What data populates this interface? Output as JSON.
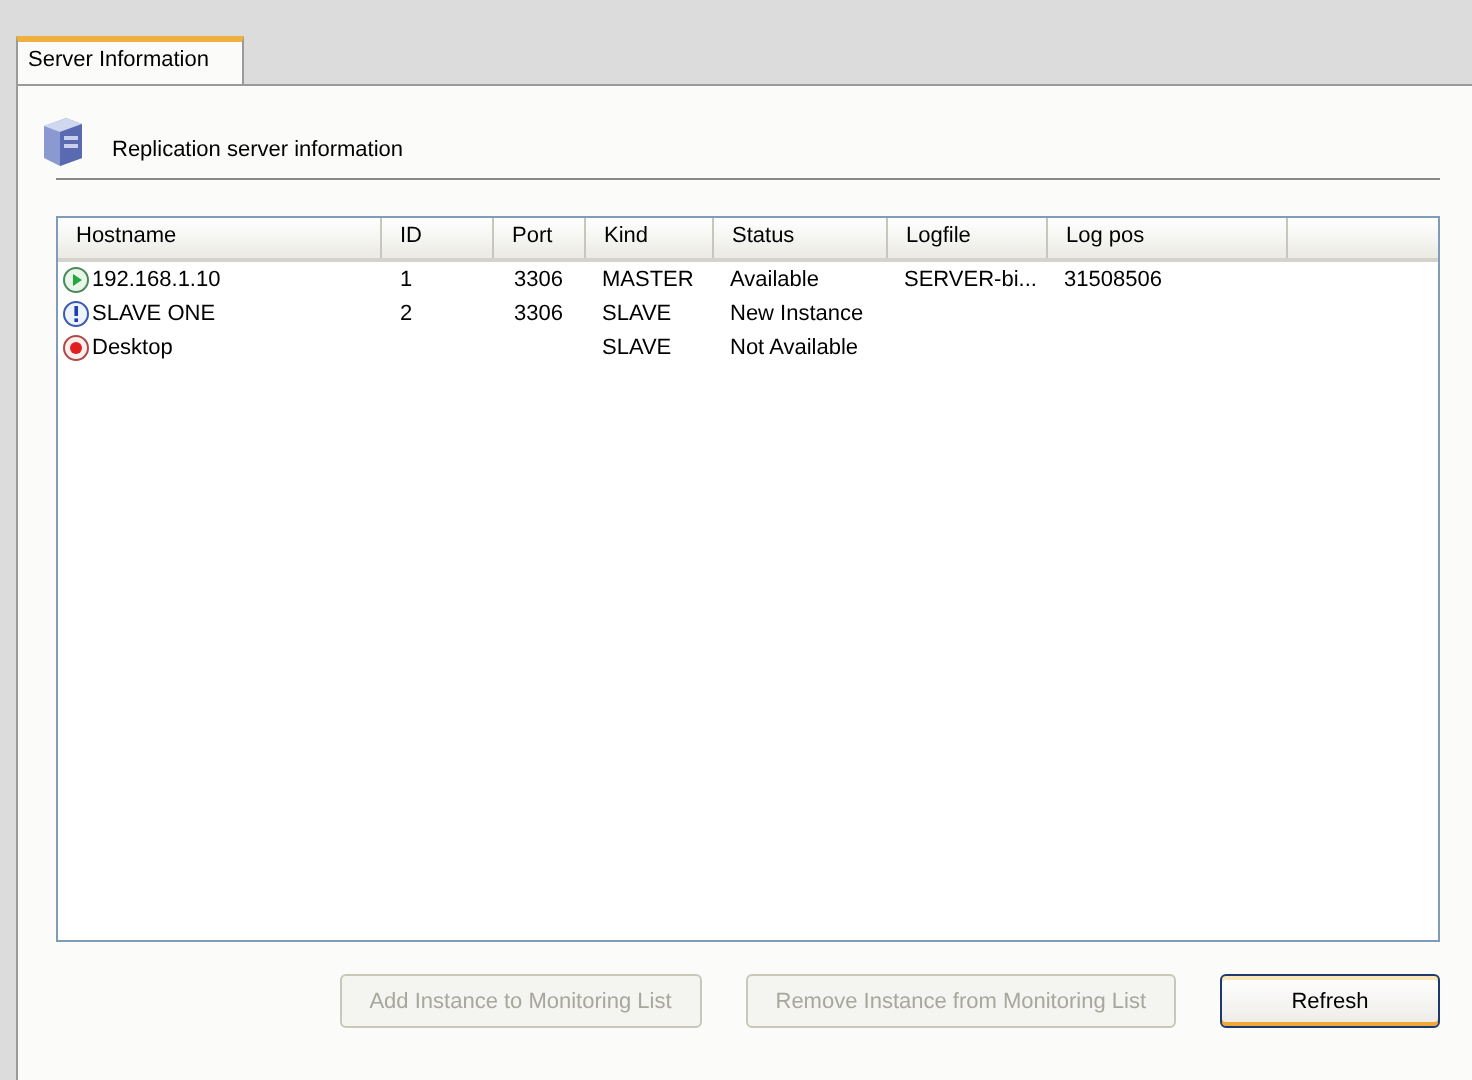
{
  "tabs": [
    {
      "label": "Server Information",
      "selected": true
    }
  ],
  "header": {
    "title": "Replication server information"
  },
  "table": {
    "columns": [
      "Hostname",
      "ID",
      "Port",
      "Kind",
      "Status",
      "Logfile",
      "Log pos"
    ],
    "rows": [
      {
        "kind": "running",
        "cells": [
          "192.168.1.10",
          "1",
          "3306",
          "MASTER",
          "Available",
          "SERVER-bi...",
          "31508506"
        ]
      },
      {
        "kind": "warning",
        "cells": [
          "SLAVE ONE",
          "2",
          "3306",
          "SLAVE",
          "New Instance",
          "",
          ""
        ]
      },
      {
        "kind": "stopped",
        "cells": [
          "Desktop",
          "",
          "",
          "SLAVE",
          "Not Available",
          "",
          ""
        ]
      }
    ]
  },
  "buttons": [
    {
      "label": "Add Instance to Monitoring List",
      "disabled": true
    },
    {
      "label": "Remove Instance from Monitoring List",
      "disabled": true
    },
    {
      "label": "Refresh",
      "disabled": false
    }
  ]
}
